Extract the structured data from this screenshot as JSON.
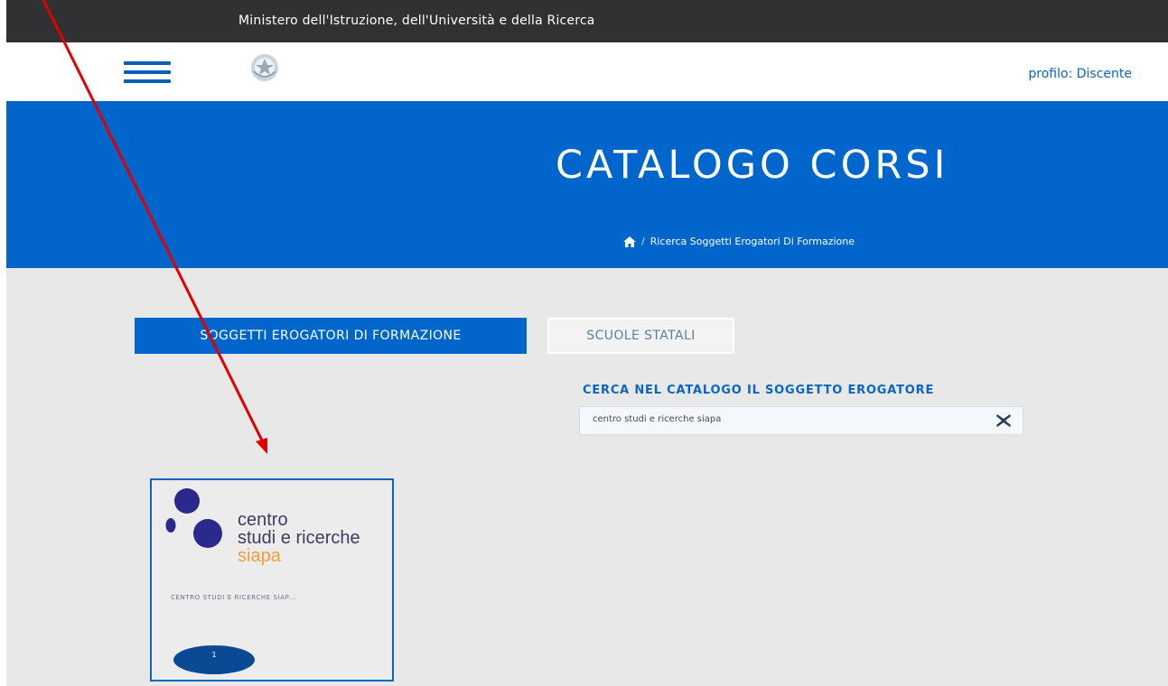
{
  "topbar": {
    "title": "Ministero dell'Istruzione, dell'Università e della Ricerca"
  },
  "header": {
    "profile_label": "profilo: Discente"
  },
  "hero": {
    "title": "CATALOGO CORSI",
    "breadcrumb": {
      "separator": "/",
      "current": "Ricerca Soggetti Erogatori Di Formazione"
    }
  },
  "tabs": [
    {
      "label": "SOGGETTI EROGATORI DI FORMAZIONE",
      "active": true
    },
    {
      "label": "SCUOLE STATALI",
      "active": false
    }
  ],
  "search": {
    "label": "CERCA NEL CATALOGO IL SOGGETTO EROGATORE",
    "value": "centro studi e ricerche siapa"
  },
  "result_card": {
    "logo": {
      "line1": "centro",
      "line2": "studi e ricerche",
      "line3": "siapa"
    },
    "name": "CENTRO STUDI E RICERCHE SIAP...",
    "count": "1"
  },
  "colors": {
    "primary": "#0066cc",
    "topbar": "#2f3133",
    "background": "#e8e8e8",
    "annotation_arrow": "#e00000",
    "logo_orange": "#f39c3a",
    "logo_navy": "#2b2a8c"
  },
  "icons": {
    "menu": "hamburger-icon",
    "emblem": "italian-republic-emblem",
    "home": "home-icon",
    "clear": "close-icon"
  }
}
